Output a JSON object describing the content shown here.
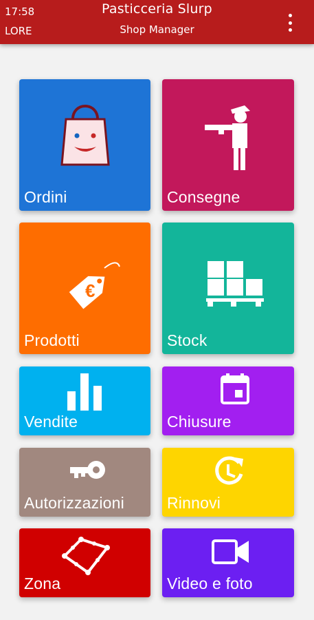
{
  "status": {
    "time": "17:58",
    "user": "LORE"
  },
  "header": {
    "title": "Pasticceria Slurp",
    "subtitle": "Shop Manager"
  },
  "menu_icon": "more-vert-icon",
  "tiles": [
    {
      "key": "ordini",
      "label": "Ordini",
      "color": "#1e74d6",
      "icon": "shopping-bag-face-icon"
    },
    {
      "key": "consegne",
      "label": "Consegne",
      "color": "#c2185b",
      "icon": "delivery-person-icon"
    },
    {
      "key": "prodotti",
      "label": "Prodotti",
      "color": "#fe6d00",
      "icon": "euro-price-tag-icon"
    },
    {
      "key": "stock",
      "label": "Stock",
      "color": "#13b59a",
      "icon": "pallet-boxes-icon"
    },
    {
      "key": "vendite",
      "label": "Vendite",
      "color": "#00b1ef",
      "icon": "bar-chart-icon"
    },
    {
      "key": "chiusure",
      "label": "Chiusure",
      "color": "#a21ff0",
      "icon": "calendar-icon"
    },
    {
      "key": "autorizzazioni",
      "label": "Autorizzazioni",
      "color": "#a1887f",
      "icon": "key-icon"
    },
    {
      "key": "rinnovi",
      "label": "Rinnovi",
      "color": "#fed500",
      "icon": "renew-clock-icon"
    },
    {
      "key": "zona",
      "label": "Zona",
      "color": "#d00000",
      "icon": "zone-polygon-icon"
    },
    {
      "key": "video",
      "label": "Video e foto",
      "color": "#6c1ff2",
      "icon": "video-camera-icon"
    }
  ]
}
